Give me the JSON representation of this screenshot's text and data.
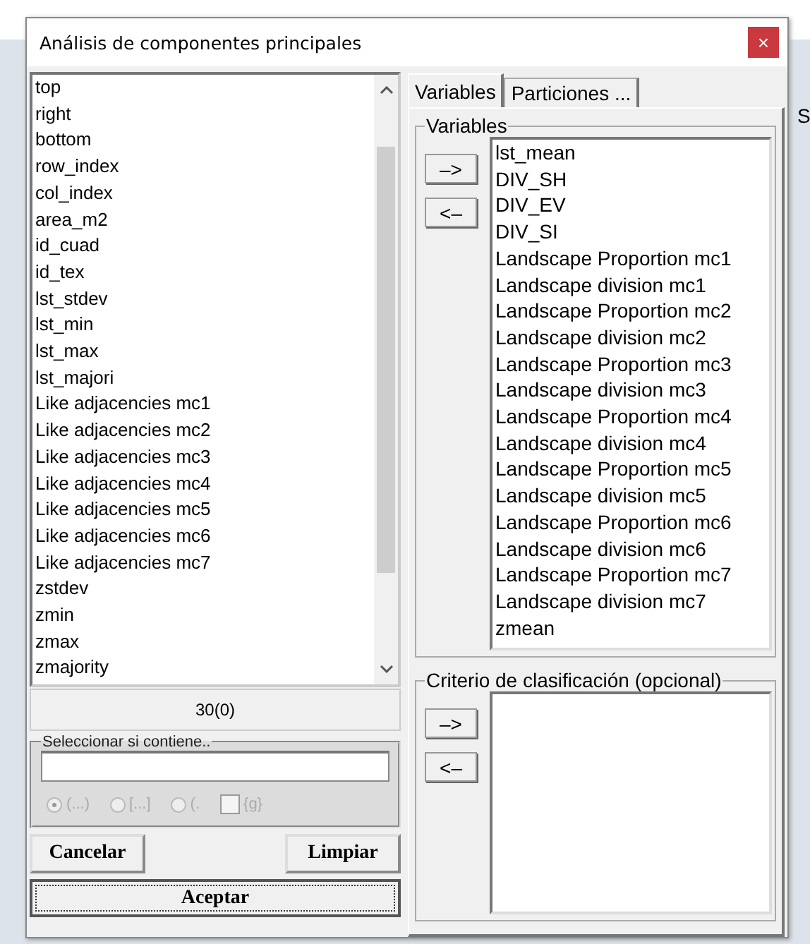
{
  "window": {
    "title": "Análisis de componentes principales",
    "close": "×"
  },
  "background": {
    "text": "S"
  },
  "source_list": {
    "items": [
      "top",
      "right",
      "bottom",
      "row_index",
      "col_index",
      "area_m2",
      "id_cuad",
      "id_tex",
      "lst_stdev",
      "lst_min",
      "lst_max",
      "lst_majori",
      "Like adjacencies mc1",
      "Like adjacencies mc2",
      "Like adjacencies mc3",
      "Like adjacencies mc4",
      "Like adjacencies mc5",
      "Like adjacencies mc6",
      "Like adjacencies mc7",
      "zstdev",
      "zmin",
      "zmax",
      "zmajority"
    ],
    "count": "30(0)"
  },
  "filter": {
    "title": "Seleccionar si contiene..",
    "options": [
      {
        "label": "(...)",
        "selected": true,
        "disabled": true
      },
      {
        "label": "[...]",
        "selected": false,
        "disabled": true
      },
      {
        "label": "(.",
        "selected": false,
        "disabled": true
      }
    ],
    "checkbox": {
      "label": "{g}",
      "checked": false,
      "disabled": true
    }
  },
  "buttons": {
    "cancel": "Cancelar",
    "clear": "Limpiar",
    "accept": "Aceptar"
  },
  "tabs": [
    {
      "label": "Variables",
      "selected": true
    },
    {
      "label": "Particiones ...",
      "selected": false
    }
  ],
  "variables": {
    "title": "Variables",
    "add": "–>",
    "remove": "<–",
    "items": [
      "lst_mean",
      "DIV_SH",
      "DIV_EV",
      "DIV_SI",
      "Landscape Proportion mc1",
      "Landscape division mc1",
      "Landscape Proportion mc2",
      "Landscape division mc2",
      "Landscape Proportion mc3",
      "Landscape division mc3",
      "Landscape Proportion mc4",
      "Landscape division mc4",
      "Landscape Proportion mc5",
      "Landscape division mc5",
      "Landscape Proportion mc6",
      "Landscape division mc6",
      "Landscape Proportion mc7",
      "Landscape division mc7",
      "zmean"
    ]
  },
  "criterion": {
    "title": "Criterio de clasificación (opcional)",
    "add": "–>",
    "remove": "<–"
  }
}
